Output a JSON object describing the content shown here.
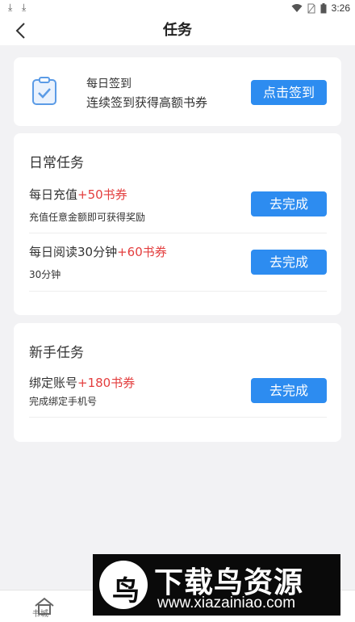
{
  "status_bar": {
    "time": "3:26",
    "icons": [
      "download-icon",
      "download-icon",
      "wifi-icon",
      "no-sim-icon",
      "battery-icon"
    ]
  },
  "header": {
    "title": "任务",
    "back_icon": "chevron-left-icon"
  },
  "checkin": {
    "icon": "clipboard-check-icon",
    "title": "每日签到",
    "subtitle": "连续签到获得高额书券",
    "button": "点击签到"
  },
  "daily_tasks": {
    "title": "日常任务",
    "items": [
      {
        "name": "每日充值",
        "reward": "+50书券",
        "desc": "充值任意金额即可获得奖励",
        "button": "去完成"
      },
      {
        "name": "每日阅读30分钟",
        "reward": "+60书券",
        "desc": "30分钟",
        "button": "去完成"
      }
    ]
  },
  "newbie_tasks": {
    "title": "新手任务",
    "items": [
      {
        "name": "绑定账号",
        "reward": "+180书券",
        "desc": "完成绑定手机号",
        "button": "去完成"
      }
    ]
  },
  "bottom_nav": {
    "home_icon": "home-icon",
    "home_label": "书城"
  },
  "watermark": {
    "title": "下载鸟资源",
    "url": "www.xiazainiao.com"
  },
  "colors": {
    "accent": "#2d8cf0",
    "reward": "#e33d3d",
    "background": "#f2f2f4"
  }
}
